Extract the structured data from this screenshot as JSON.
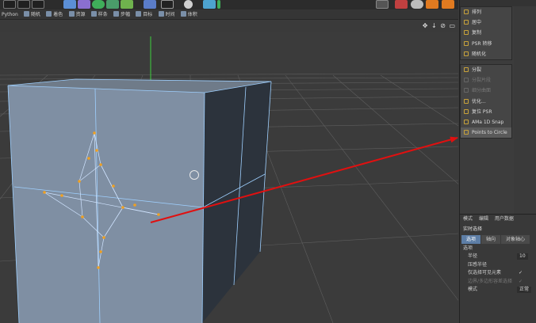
{
  "menubar": {
    "items": [
      {
        "label": "Python",
        "icon": "python-icon"
      },
      {
        "label": "随机",
        "icon": "random-icon"
      },
      {
        "label": "着色",
        "icon": "shader-icon"
      },
      {
        "label": "资源",
        "icon": "asset-icon"
      },
      {
        "label": "样条",
        "icon": "spline-icon"
      },
      {
        "label": "步幅",
        "icon": "stride-icon"
      },
      {
        "label": "目标",
        "icon": "target-icon"
      },
      {
        "label": "时间",
        "icon": "time-icon"
      },
      {
        "label": "体积",
        "icon": "volume-icon"
      }
    ]
  },
  "viewport": {
    "nav_icons": "✥ ↓ ⊘ ▭"
  },
  "context_menu": {
    "group1": [
      {
        "label": "排列",
        "enabled": true
      },
      {
        "label": "居中",
        "enabled": true
      },
      {
        "label": "复制",
        "enabled": true
      },
      {
        "label": "PSR 转移",
        "enabled": true
      },
      {
        "label": "随机化",
        "enabled": true
      }
    ],
    "group2": [
      {
        "label": "分裂",
        "enabled": true
      },
      {
        "label": "分裂片段",
        "enabled": false
      },
      {
        "label": "细分曲面",
        "enabled": false
      },
      {
        "label": "优化...",
        "enabled": true
      },
      {
        "label": "复位 PSR",
        "enabled": true
      },
      {
        "label": "AMa 1D Snap",
        "enabled": true
      },
      {
        "label": "Points to Circle",
        "enabled": true
      }
    ]
  },
  "attributes": {
    "menu": [
      "模式",
      "编辑",
      "用户数据"
    ],
    "title": "实时选择",
    "tabs": [
      "选项",
      "轴向",
      "对象轴心"
    ],
    "section": "选项",
    "props": [
      {
        "label": "半径",
        "value": "10",
        "enabled": true
      },
      {
        "label": "压感半径",
        "check": "",
        "enabled": true
      },
      {
        "label": "仅选择可见元素",
        "check": "✓",
        "enabled": true
      },
      {
        "label": "边界/多边形容差选择",
        "check": "✓",
        "enabled": false
      },
      {
        "label": "模式",
        "value": "正常",
        "enabled": true
      }
    ]
  },
  "colors": {
    "background": "#3b3b3b",
    "cube_front": "#7f8fa3",
    "cube_side": "#2c333c",
    "edge": "#9fd0ff",
    "point": "#f0a020",
    "arrow": "#e01010",
    "y_axis": "#3ccf3c"
  }
}
